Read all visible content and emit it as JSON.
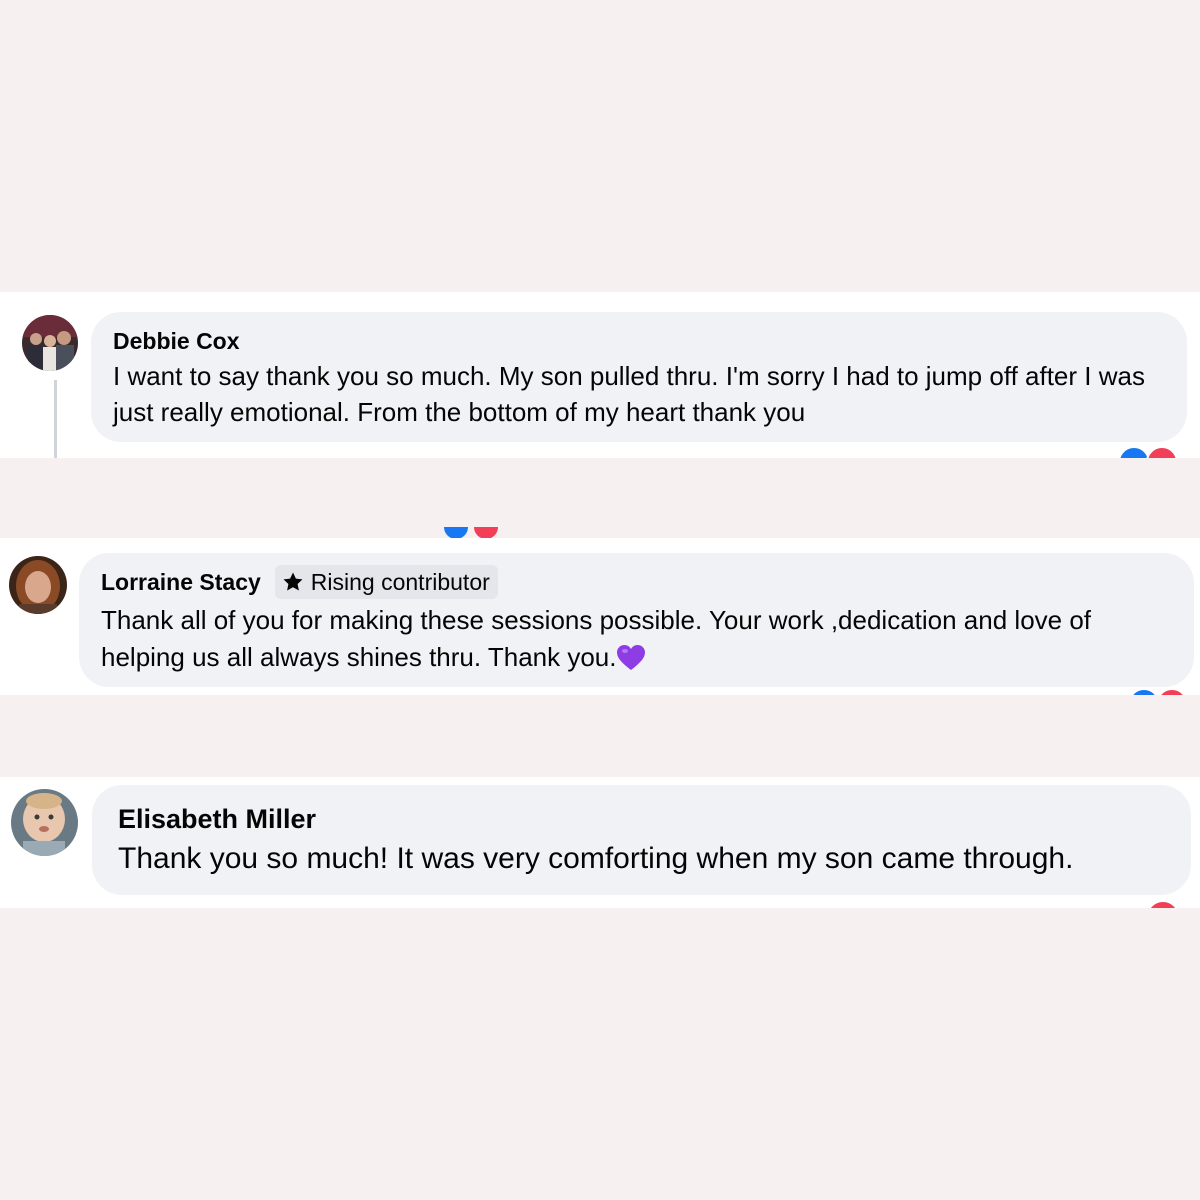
{
  "comments": [
    {
      "author": "Debbie Cox",
      "text": "I want to say thank you so much. My son pulled thru. I'm sorry I had to jump off after I was just really emotional. From the bottom of my heart thank you",
      "avatar_icon": "avatar-photo-group"
    },
    {
      "author": "Lorraine Stacy",
      "badge": "Rising contributor",
      "badge_icon": "star-icon",
      "text": "Thank all of you for making these sessions possible. Your work ,dedication and love of helping us all always shines thru. Thank you.",
      "emoji": "purple-heart",
      "avatar_icon": "avatar-photo-woman"
    },
    {
      "author": "Elisabeth Miller",
      "text": "Thank you so much! It was very comforting when my son came through.",
      "avatar_icon": "avatar-photo-baby"
    }
  ],
  "colors": {
    "background": "#f7f0f0",
    "bubble": "#f0f2f5",
    "like_blue": "#1877f2",
    "love_red": "#f33e58",
    "purple_heart": "#8e3ce6"
  }
}
